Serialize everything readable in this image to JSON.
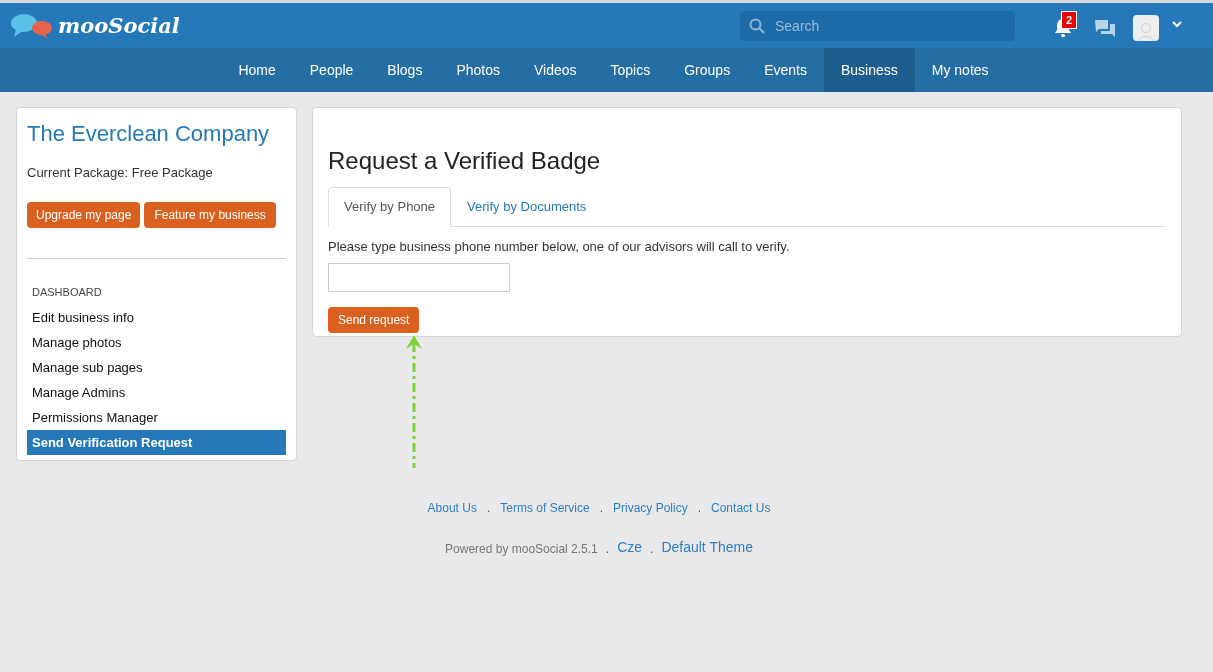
{
  "header": {
    "logo": "mooSocial",
    "search": {
      "placeholder": "Search"
    },
    "notifications": {
      "count": "2"
    }
  },
  "nav": [
    {
      "label": "Home",
      "selected": false
    },
    {
      "label": "People",
      "selected": false
    },
    {
      "label": "Blogs",
      "selected": false
    },
    {
      "label": "Photos",
      "selected": false
    },
    {
      "label": "Videos",
      "selected": false
    },
    {
      "label": "Topics",
      "selected": false
    },
    {
      "label": "Groups",
      "selected": false
    },
    {
      "label": "Events",
      "selected": false
    },
    {
      "label": "Business",
      "selected": true
    },
    {
      "label": "My notes",
      "selected": false
    }
  ],
  "sidebar": {
    "title": "The Everclean Company",
    "package": "Current Package: Free Package",
    "buttons": [
      "Upgrade my page",
      "Feature my business"
    ],
    "section": "DASHBOARD",
    "items": [
      {
        "label": "Edit business info",
        "selected": false
      },
      {
        "label": "Manage photos",
        "selected": false
      },
      {
        "label": "Manage sub pages",
        "selected": false
      },
      {
        "label": "Manage Admins",
        "selected": false
      },
      {
        "label": "Permissions Manager",
        "selected": false
      },
      {
        "label": "Send Verification Request",
        "selected": true
      }
    ]
  },
  "main": {
    "title": "Request a Verified Badge",
    "tabs": [
      {
        "label": "Verify by Phone",
        "selected": true
      },
      {
        "label": "Verify by Documents",
        "selected": false
      }
    ],
    "instruction": "Please type business phone number below, one of our advisors will call to verify.",
    "submit": "Send request"
  },
  "footer": {
    "links": [
      {
        "kind": "link",
        "text": "About Us"
      },
      {
        "kind": "separator",
        "text": "."
      },
      {
        "kind": "link",
        "text": "Terms of Service"
      },
      {
        "kind": "separator",
        "text": "."
      },
      {
        "kind": "link",
        "text": "Privacy Policy"
      },
      {
        "kind": "separator",
        "text": "."
      },
      {
        "kind": "link",
        "text": "Contact Us"
      }
    ],
    "bottom": [
      {
        "kind": "text",
        "text": "Powered by mooSocial 2.5.1"
      },
      {
        "kind": "separator",
        "text": "."
      },
      {
        "kind": "link",
        "text": "Cze"
      },
      {
        "kind": "separator",
        "text": "."
      },
      {
        "kind": "link",
        "text": "Default Theme"
      }
    ]
  }
}
